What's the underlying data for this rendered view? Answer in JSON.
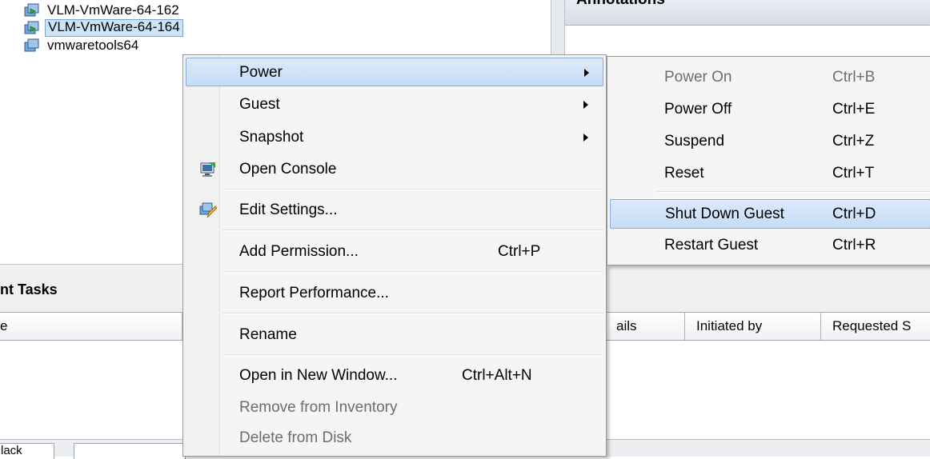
{
  "tree": {
    "items": [
      {
        "label": "VLM-VmWare-64-162",
        "selected": false
      },
      {
        "label": "VLM-VmWare-64-164",
        "selected": true
      },
      {
        "label": "vmwaretools64",
        "selected": false
      }
    ]
  },
  "annotations": {
    "title": "Annotations"
  },
  "tasks": {
    "title": "nt Tasks",
    "columns": [
      "e",
      "ails",
      "Initiated by",
      "Requested S"
    ]
  },
  "bottom_tabs": [
    "lack",
    ""
  ],
  "context_menu": {
    "items": [
      {
        "label": "Power",
        "submenu": true
      },
      {
        "label": "Guest",
        "submenu": true
      },
      {
        "label": "Snapshot",
        "submenu": true
      },
      {
        "label": "Open Console",
        "icon": "console-icon"
      },
      {
        "label": "Edit Settings...",
        "icon": "edit-settings-icon"
      },
      {
        "label": "Add Permission...",
        "shortcut": "Ctrl+P"
      },
      {
        "label": "Report Performance..."
      },
      {
        "label": "Rename"
      },
      {
        "label": "Open in New Window...",
        "shortcut": "Ctrl+Alt+N"
      },
      {
        "label": "Remove from Inventory",
        "disabled": true
      },
      {
        "label": "Delete from Disk",
        "disabled": true
      }
    ]
  },
  "power_submenu": {
    "items": [
      {
        "label": "Power On",
        "shortcut": "Ctrl+B",
        "disabled": true
      },
      {
        "label": "Power Off",
        "shortcut": "Ctrl+E"
      },
      {
        "label": "Suspend",
        "shortcut": "Ctrl+Z"
      },
      {
        "label": "Reset",
        "shortcut": "Ctrl+T"
      },
      {
        "label": "Shut Down Guest",
        "shortcut": "Ctrl+D",
        "highlighted": true
      },
      {
        "label": "Restart Guest",
        "shortcut": "Ctrl+R"
      }
    ]
  },
  "colors": {
    "highlight": "#c5dcf6",
    "highlight_border": "#84acdd",
    "disabled_text": "#6d6d6d",
    "vm_icon_green": "#3aa635"
  }
}
